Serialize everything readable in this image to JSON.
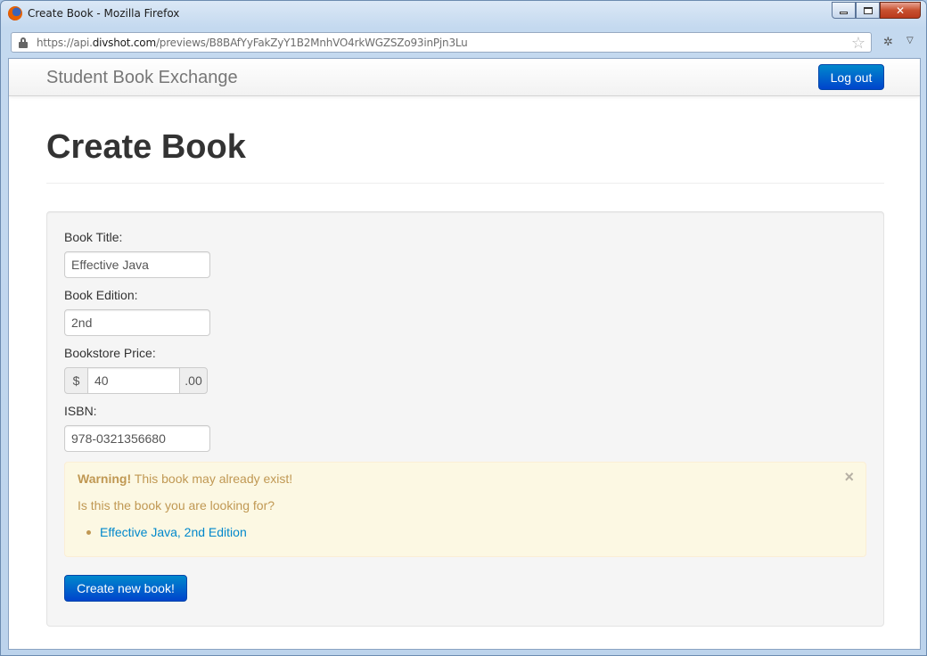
{
  "window": {
    "title": "Create Book - Mozilla Firefox",
    "url_prefix": "https://api.",
    "url_domain": "divshot.com",
    "url_path": "/previews/B8BAfYyFakZyY1B2MnhVO4rkWGZSZo93inPjn3Lu"
  },
  "nav": {
    "brand": "Student Book Exchange",
    "logout_label": "Log out"
  },
  "page": {
    "title": "Create Book"
  },
  "form": {
    "title_label": "Book Title:",
    "title_value": "Effective Java",
    "edition_label": "Book Edition:",
    "edition_value": "2nd",
    "price_label": "Bookstore Price:",
    "price_prefix": "$",
    "price_value": "40",
    "price_suffix": ".00",
    "isbn_label": "ISBN:",
    "isbn_value": "978-0321356680",
    "submit_label": "Create new book!"
  },
  "alert": {
    "strong": "Warning!",
    "message": "This book may already exist!",
    "question": "Is this the book you are looking for?",
    "suggestion": "Effective Java, 2nd Edition",
    "close": "×"
  },
  "colors": {
    "primary": "#0088cc",
    "alert_bg": "#fcf8e3",
    "alert_text": "#c09853"
  }
}
